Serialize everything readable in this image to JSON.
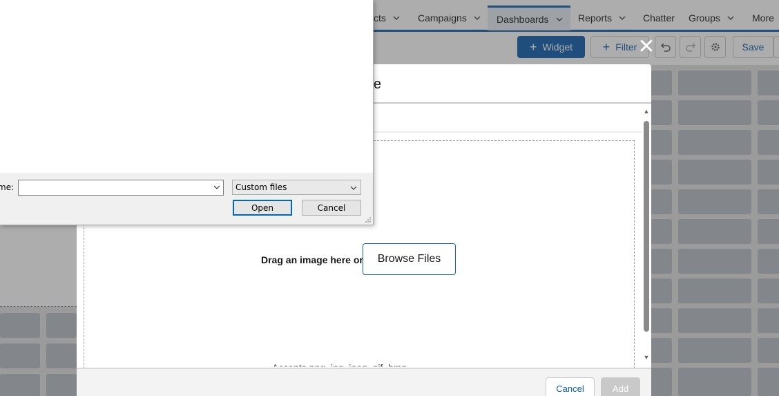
{
  "nav": {
    "items": [
      {
        "label": "cts"
      },
      {
        "label": "Campaigns"
      },
      {
        "label": "Dashboards"
      },
      {
        "label": "Reports"
      },
      {
        "label": "Chatter"
      },
      {
        "label": "Groups"
      },
      {
        "label": "More"
      }
    ]
  },
  "toolbar": {
    "widget_label": "Widget",
    "filter_label": "Filter",
    "save_label": "Save"
  },
  "modal": {
    "title": "mage",
    "drag_text": "Drag an image here or",
    "browse_label": "Browse Files",
    "accept_text": "Accepts png, jpg, jpeg, gif, bmp",
    "cancel_label": "Cancel",
    "add_label": "Add"
  },
  "file_dialog": {
    "name_label": "me:",
    "name_value": "",
    "file_type": "Custom files",
    "open_label": "Open",
    "cancel_label": "Cancel"
  },
  "colors": {
    "brand": "#0b5cab",
    "overlay": "#3c3c3c"
  }
}
